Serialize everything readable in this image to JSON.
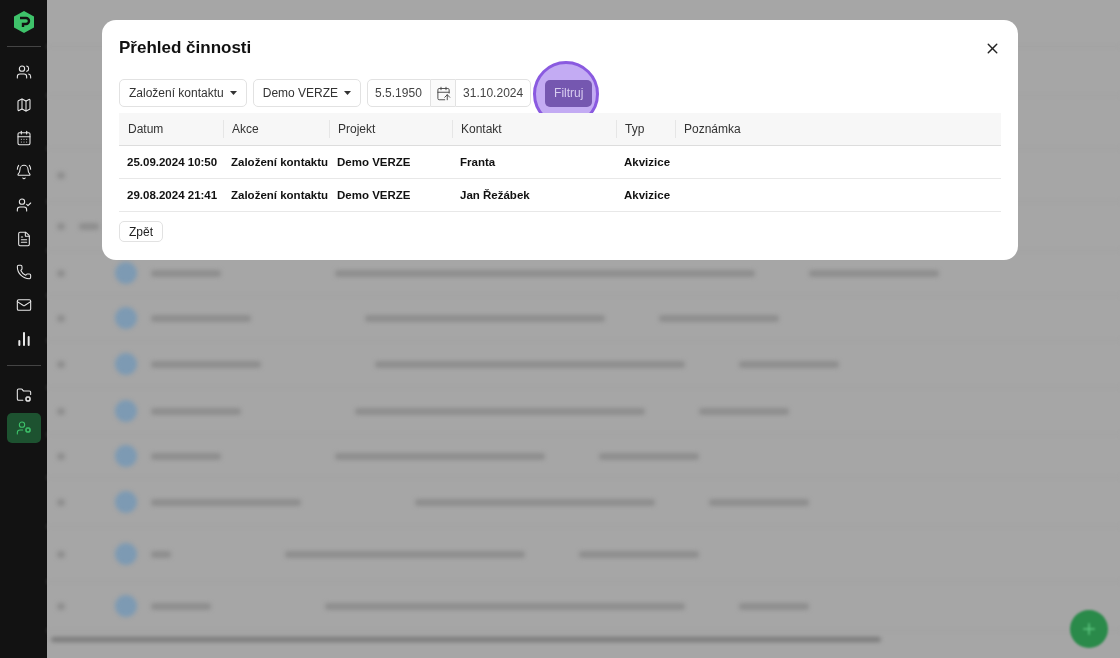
{
  "sidebar": {
    "items": [
      {
        "selected": false
      },
      {
        "selected": false
      },
      {
        "selected": false
      },
      {
        "selected": false
      },
      {
        "selected": false
      },
      {
        "selected": false
      },
      {
        "selected": false
      },
      {
        "selected": false
      },
      {
        "selected": false
      },
      {
        "selected": false
      },
      {
        "selected": true
      }
    ]
  },
  "dialog": {
    "title": "Přehled činnosti",
    "filters": {
      "action": "Založení kontaktu",
      "project": "Demo VERZE",
      "date_from": "5.5.1950",
      "date_to": "31.10.2024",
      "submit": "Filtruj",
      "submit_clicked": true
    },
    "table": {
      "columns": [
        "Datum",
        "Akce",
        "Projekt",
        "Kontakt",
        "Typ",
        "Poznámka"
      ],
      "rows": [
        [
          "25.09.2024 10:50",
          "Založení kontaktu",
          "Demo VERZE",
          "Franta",
          "Akvizice",
          null
        ],
        [
          "29.08.2024 21:41",
          "Založení kontaktu",
          "Demo VERZE",
          "Jan Řežábek",
          "Akvizice",
          null
        ]
      ]
    },
    "back_button": "Zpět"
  }
}
